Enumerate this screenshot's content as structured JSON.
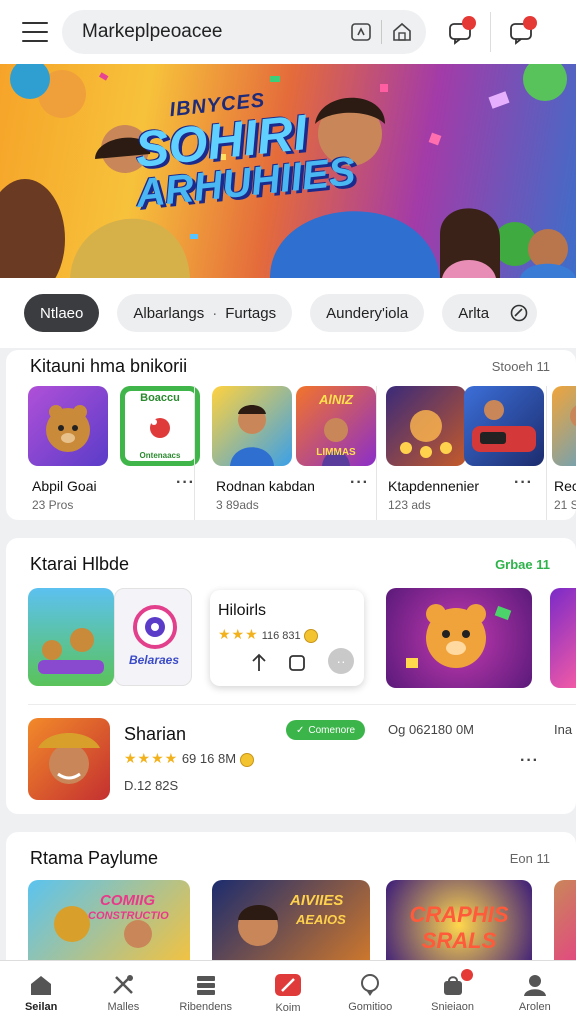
{
  "topbar": {
    "search_text": "Markeplpeoacee",
    "icons": [
      "menu-icon",
      "scan-icon",
      "store-icon",
      "chat-icon",
      "chat-alert-icon"
    ],
    "badge1": "",
    "badge2": ""
  },
  "banner": {
    "line1": "IBNYCES",
    "line2": "SOHIRI",
    "line3": "ARHUHIIES"
  },
  "chips": [
    {
      "label": "Ntlaeo"
    },
    {
      "label": "Albarlangs",
      "label2": "Furtags"
    },
    {
      "label": "Aundery'iola"
    },
    {
      "label": "Arlta"
    }
  ],
  "section1": {
    "title": "Kitauni hma bnikorii",
    "link": "Stooeh 11",
    "items": [
      {
        "name": "Abpil Goai",
        "sub": "23 Pros"
      },
      {
        "name": "Rodnan kabdan",
        "sub": "3 89ads"
      },
      {
        "name": "Ktapdennenier",
        "sub": "123 ads"
      },
      {
        "name": "Rec",
        "sub": "21 S"
      }
    ],
    "tile_texts": [
      "Boaccu",
      "Ontenaacs",
      "AlNIZ",
      "LIMMAS"
    ]
  },
  "section2": {
    "title": "Ktarai Hlbde",
    "link": "Grbae 11",
    "tile_label": "Belaraes",
    "popup": {
      "title": "Hiloirls",
      "rating_text": "116 831"
    },
    "row": {
      "name": "Sharian",
      "rating_text": "69 16 8M",
      "sub": "D.12 82S",
      "pill": "Comenore",
      "meta": "Og 062180 0M",
      "meta2": "Ina"
    }
  },
  "section3": {
    "title": "Rtama Paylume",
    "link": "Eon 11",
    "tile_texts": [
      "COMIIG",
      "CONSTRUCTIO",
      "AIVIIES",
      "AEAIOS",
      "CRAPHIS",
      "SRALS"
    ]
  },
  "bottomnav": [
    {
      "label": "Seilan",
      "icon": "home-icon"
    },
    {
      "label": "Malles",
      "icon": "tools-icon"
    },
    {
      "label": "Ribendens",
      "icon": "layers-icon"
    },
    {
      "label": "Koim",
      "icon": "ticket-icon"
    },
    {
      "label": "Gomitioo",
      "icon": "map-pin-icon"
    },
    {
      "label": "Snieiaon",
      "icon": "bag-icon"
    },
    {
      "label": "Arolen",
      "icon": "profile-icon"
    }
  ],
  "colors": {
    "accent_green": "#3bb54a",
    "badge_red": "#e53935",
    "chip_active": "#3a3c40",
    "star": "#f2b21d"
  }
}
